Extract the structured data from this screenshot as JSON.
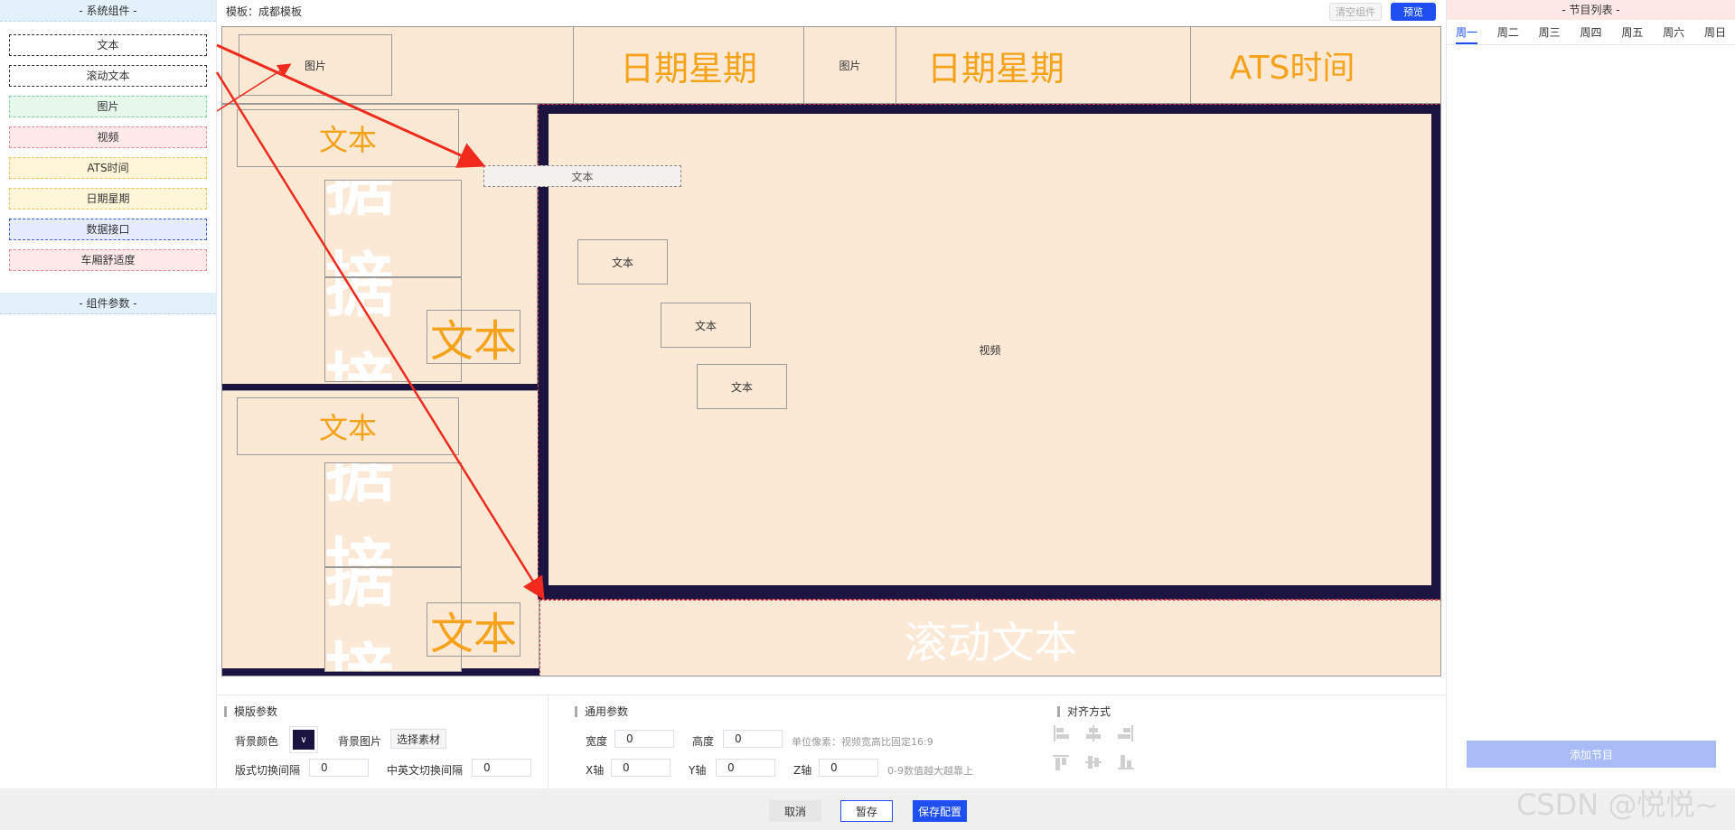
{
  "left_panel": {
    "header": "- 系统组件 -",
    "components": [
      "文本",
      "滚动文本",
      "图片",
      "视频",
      "ATS时间",
      "日期星期",
      "数据接口",
      "车厢舒适度"
    ],
    "params_header": "- 组件参数 -"
  },
  "topbar": {
    "template_label": "模板：成都模板",
    "clear_button": "清空组件",
    "preview_button": "预览"
  },
  "canvas": {
    "top_image_1": "图片",
    "top_date_1": "日期星期",
    "top_image_2": "图片",
    "top_date_2": "日期星期",
    "top_ats": "ATS时间",
    "left_upper_text": "文本",
    "left_upper_data_1": "据接",
    "left_upper_data_2": "据接",
    "left_upper_text_overlay": "文本",
    "left_lower_text": "文本",
    "left_lower_data_1": "据接",
    "left_lower_data_2": "据接",
    "left_lower_text_overlay": "文本",
    "dragging_text": "文本",
    "video_label": "视频",
    "video_text_1": "文本",
    "video_text_2": "文本",
    "video_text_3": "文本",
    "scroll_text": "滚动文本"
  },
  "bottom_panel": {
    "template_params_title": "模版参数",
    "bg_color_label": "背景颜色",
    "bg_image_label": "背景图片",
    "select_material_button": "选择素材",
    "layout_interval_label": "版式切换间隔",
    "layout_interval_value": "0",
    "lang_interval_label": "中英文切换间隔",
    "lang_interval_value": "0",
    "general_params_title": "通用参数",
    "width_label": "宽度",
    "width_value": "0",
    "height_label": "高度",
    "height_value": "0",
    "unit_hint": "单位像素：视频宽高比固定16:9",
    "x_label": "X轴",
    "x_value": "0",
    "y_label": "Y轴",
    "y_value": "0",
    "z_label": "Z轴",
    "z_value": "0",
    "z_hint": "0-9数值越大越靠上",
    "align_title": "对齐方式"
  },
  "right_panel": {
    "header": "- 节目列表 -",
    "days": [
      "周一",
      "周二",
      "周三",
      "周四",
      "周五",
      "周六",
      "周日"
    ],
    "active_day": "周一",
    "add_button": "添加节目"
  },
  "footer": {
    "cancel": "取消",
    "draft": "暂存",
    "save": "保存配置"
  },
  "watermark": "CSDN @悦悦~",
  "colors": {
    "accent": "#1f4ff0",
    "canvas_bg": "#fbe9d6",
    "frame_dark": "#1b1340",
    "orange_text": "#f6a21a",
    "arrow_red": "#f02b1d"
  }
}
